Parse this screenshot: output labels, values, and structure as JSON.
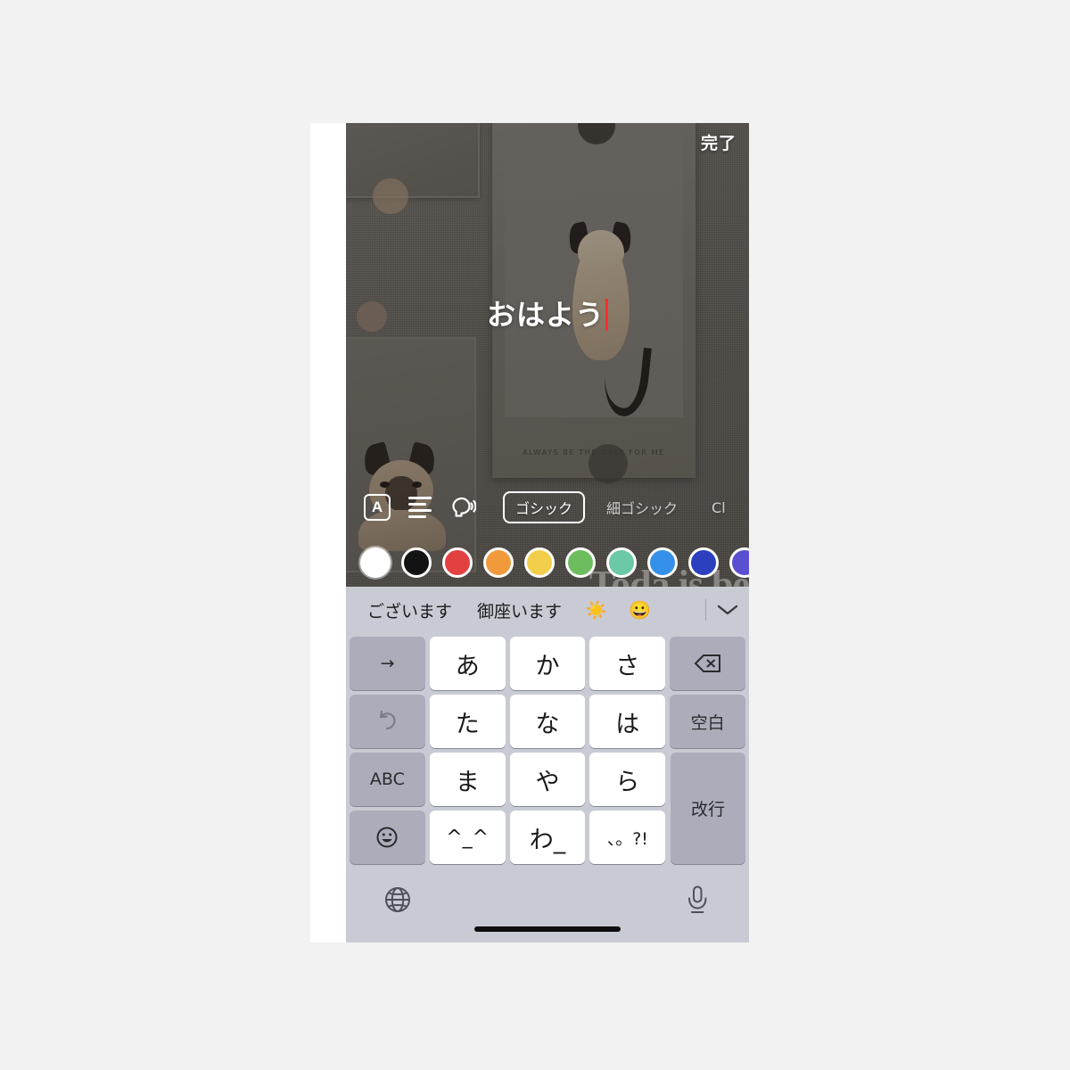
{
  "app": {
    "done_label": "完了"
  },
  "photo": {
    "poster_caption": "ALWAYS BE THE ONLY FOR ME",
    "background_poster_text": "Toda\nis be"
  },
  "overlay": {
    "text": "おはよう",
    "caret_color": "#ff2d2d",
    "text_color": "#ffffff"
  },
  "style_toolbar": {
    "icons": [
      {
        "name": "text-style-icon",
        "glyph": "A"
      },
      {
        "name": "text-align-icon",
        "glyph": "align"
      },
      {
        "name": "speak-text-icon",
        "glyph": "speak"
      }
    ],
    "fonts": [
      {
        "label": "ゴシック",
        "selected": true
      },
      {
        "label": "細ゴシック",
        "selected": false
      },
      {
        "label": "Cl",
        "selected": false
      }
    ]
  },
  "color_palette": {
    "selected_index": 0,
    "colors": [
      {
        "name": "white",
        "hex": "#ffffff"
      },
      {
        "name": "black",
        "hex": "#131313"
      },
      {
        "name": "red",
        "hex": "#e34040"
      },
      {
        "name": "orange",
        "hex": "#f09a3c"
      },
      {
        "name": "yellow",
        "hex": "#f2ce4a"
      },
      {
        "name": "green",
        "hex": "#6dbd5f"
      },
      {
        "name": "mint",
        "hex": "#6cc9a5"
      },
      {
        "name": "light-blue",
        "hex": "#3490e8"
      },
      {
        "name": "dark-blue",
        "hex": "#2b3fbf"
      },
      {
        "name": "purple",
        "hex": "#5a4fd0"
      }
    ]
  },
  "keyboard": {
    "suggestions": [
      {
        "type": "word",
        "label": "ございます"
      },
      {
        "type": "word",
        "label": "御座います"
      },
      {
        "type": "emoji",
        "label": "☀️"
      },
      {
        "type": "emoji",
        "label": "😀"
      }
    ],
    "chevron_icon": "chevron-down-icon",
    "rows": [
      [
        {
          "name": "key-arrow-right",
          "label": "→",
          "kind": "fn"
        },
        {
          "name": "key-a",
          "label": "あ",
          "kind": "char"
        },
        {
          "name": "key-ka",
          "label": "か",
          "kind": "char"
        },
        {
          "name": "key-sa",
          "label": "さ",
          "kind": "char"
        },
        {
          "name": "key-delete",
          "label": "⌫",
          "kind": "fn"
        }
      ],
      [
        {
          "name": "key-undo",
          "label": "↺",
          "kind": "fn"
        },
        {
          "name": "key-ta",
          "label": "た",
          "kind": "char"
        },
        {
          "name": "key-na",
          "label": "な",
          "kind": "char"
        },
        {
          "name": "key-ha",
          "label": "は",
          "kind": "char"
        },
        {
          "name": "key-space",
          "label": "空白",
          "kind": "fn"
        }
      ],
      [
        {
          "name": "key-abc",
          "label": "ABC",
          "kind": "fn"
        },
        {
          "name": "key-ma",
          "label": "ま",
          "kind": "char"
        },
        {
          "name": "key-ya",
          "label": "や",
          "kind": "char"
        },
        {
          "name": "key-ra",
          "label": "ら",
          "kind": "char"
        }
      ],
      [
        {
          "name": "key-emoji",
          "label": "☺",
          "kind": "fn"
        },
        {
          "name": "key-kaomoji",
          "label": "^_^",
          "kind": "char"
        },
        {
          "name": "key-wa",
          "label": "わ_",
          "kind": "char"
        },
        {
          "name": "key-punct",
          "label": "、。?!",
          "kind": "char"
        }
      ]
    ],
    "enter_key": {
      "name": "key-enter",
      "label": "改行"
    },
    "globe_icon": "globe-icon",
    "mic_icon": "microphone-icon"
  }
}
